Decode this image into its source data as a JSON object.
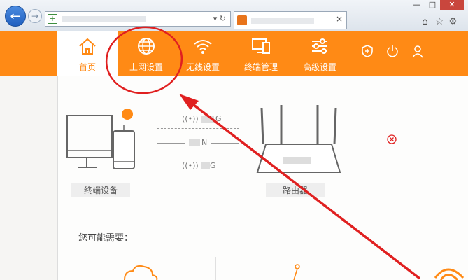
{
  "browser": {
    "back_icon": "back-arrow-icon",
    "forward_icon": "forward-arrow-icon",
    "window_controls": [
      "—",
      "□",
      "✕"
    ],
    "tools": [
      "home-icon",
      "star-icon",
      "gear-icon"
    ]
  },
  "router": {
    "nav": [
      {
        "label": "首页",
        "icon": "home-icon",
        "active": true
      },
      {
        "label": "上网设置",
        "icon": "globe-icon",
        "active": false
      },
      {
        "label": "无线设置",
        "icon": "wifi-icon",
        "active": false
      },
      {
        "label": "终端管理",
        "icon": "devices-icon",
        "active": false
      },
      {
        "label": "高级设置",
        "icon": "sliders-icon",
        "active": false
      }
    ],
    "right_icons": [
      "shield-icon",
      "power-icon",
      "user-icon"
    ],
    "terminal_label": "终端设备",
    "router_label": "路由器",
    "link_labels": [
      "G",
      "N",
      "G"
    ],
    "hint": "您可能需要："
  },
  "colors": {
    "brand": "#ff8a15",
    "annotation": "#e02020"
  }
}
